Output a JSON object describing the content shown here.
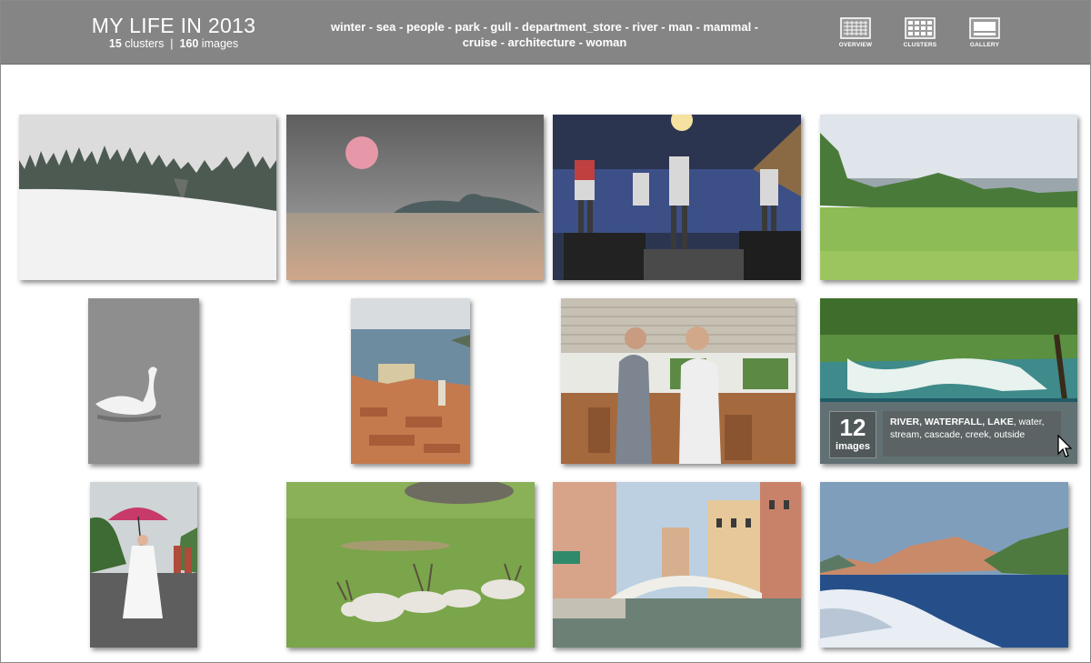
{
  "header": {
    "title": "MY LIFE IN 2013",
    "clusters_count": "15",
    "clusters_label": " clusters  |  ",
    "images_count": "160",
    "images_label": " images",
    "tags": "winter - sea - people - park - gull - department_store - river - man - mammal - cruise - architecture - woman"
  },
  "nav": [
    {
      "label": "OVERVIEW",
      "icon": "overview-icon"
    },
    {
      "label": "CLUSTERS",
      "icon": "clusters-icon"
    },
    {
      "label": "GALLERY",
      "icon": "gallery-icon"
    }
  ],
  "clusters": [
    {
      "subject": "winter-snow-forest"
    },
    {
      "subject": "sunset-sea-island"
    },
    {
      "subject": "band-concert-stage"
    },
    {
      "subject": "green-meadow-park"
    },
    {
      "subject": "swan-on-water"
    },
    {
      "subject": "coastal-old-town"
    },
    {
      "subject": "people-in-restaurant"
    },
    {
      "subject": "waterfall-river",
      "hovered": true
    },
    {
      "subject": "bride-with-umbrella"
    },
    {
      "subject": "antelopes-on-grass"
    },
    {
      "subject": "venice-canal-bridge"
    },
    {
      "subject": "sea-cruise-coast"
    }
  ],
  "hover_overlay": {
    "count": "12",
    "count_label": "images",
    "bold_tags": "RIVER, WATERFALL, LAKE",
    "other_tags": ", water, stream, cascade, creek, outside"
  },
  "colors": {
    "header_bg": "#858585",
    "text": "#ffffff",
    "page_bg": "#ffffff"
  }
}
